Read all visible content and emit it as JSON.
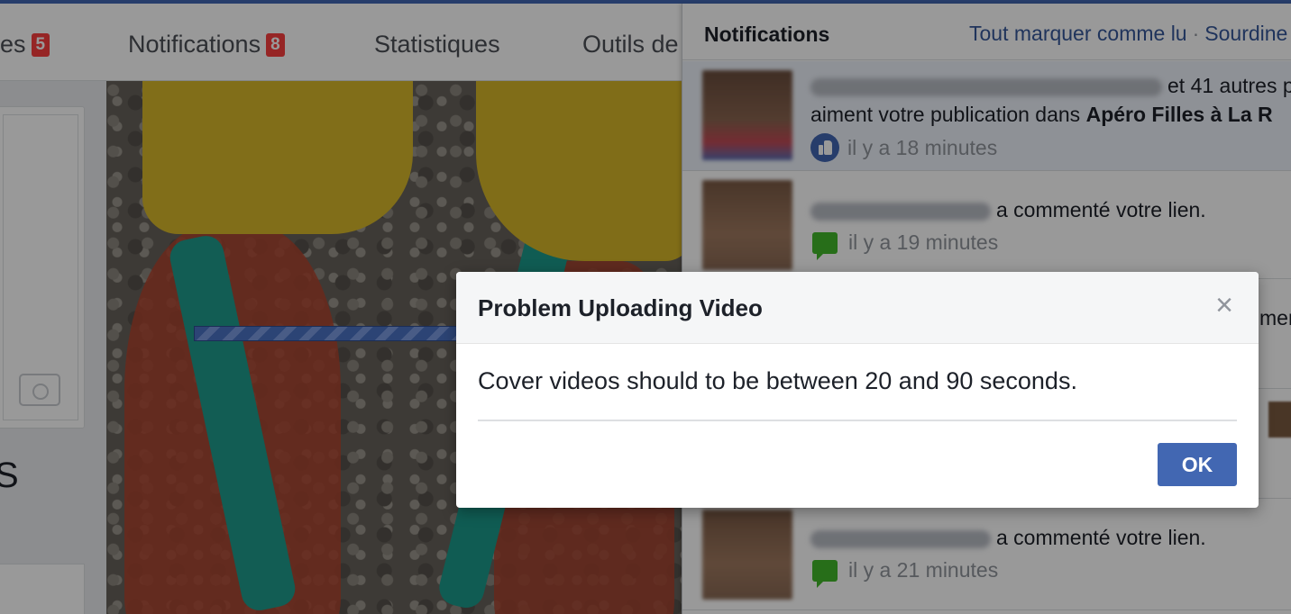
{
  "tabs": [
    {
      "label": "es",
      "badge": "5"
    },
    {
      "label": "Notifications",
      "badge": "8"
    },
    {
      "label": "Statistiques"
    },
    {
      "label": "Outils de"
    }
  ],
  "left": {
    "letter": "S"
  },
  "notifications": {
    "title": "Notifications",
    "mark_all_read": "Tout marquer comme lu",
    "separator": "·",
    "mute": "Sourdine",
    "items": [
      {
        "text_line1": "et 41 autres p",
        "text_line2_prefix": "aiment votre publication dans",
        "text_line2_bold": "Apéro Filles à La R",
        "time": "il y a 18 minutes",
        "icon": "like-icon"
      },
      {
        "text_line1": "a commenté votre lien.",
        "time": "il y a 19 minutes",
        "icon": "comment-icon"
      },
      {
        "text_line1": "a commenté votre lien.",
        "time": "il y a 21 minutes",
        "icon": "comment-icon"
      }
    ],
    "partial_text": "mer"
  },
  "dialog": {
    "title": "Problem Uploading Video",
    "close": "×",
    "message": "Cover videos should to be between 20 and 90 seconds.",
    "ok_label": "OK"
  }
}
